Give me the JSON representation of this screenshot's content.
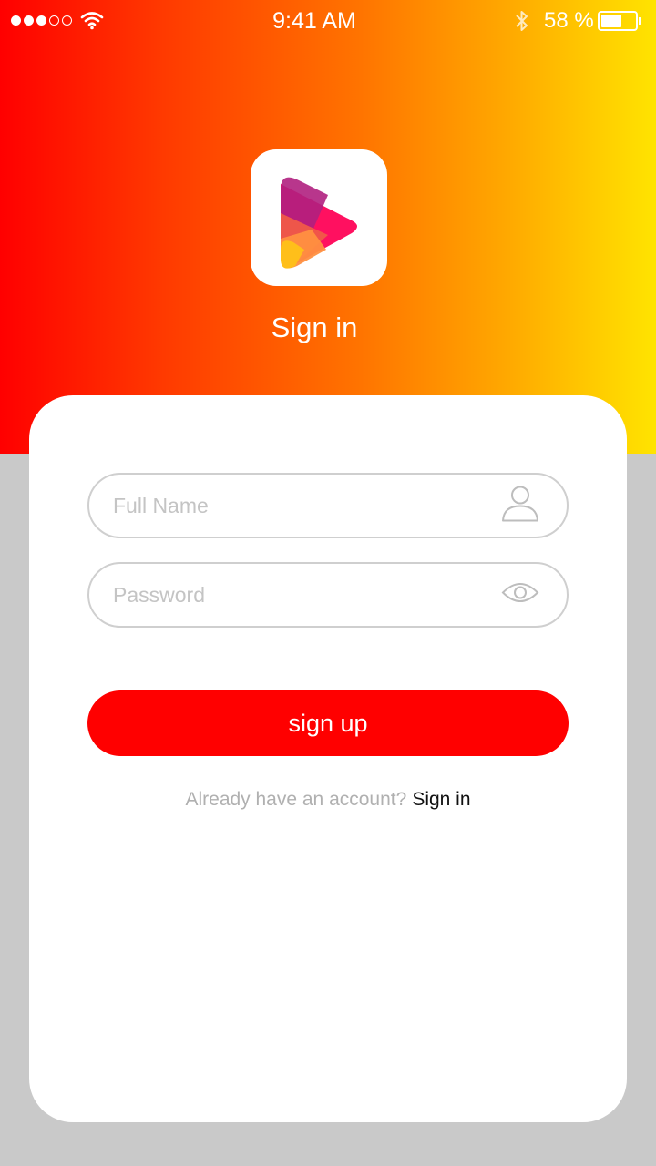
{
  "status_bar": {
    "time": "9:41 AM",
    "battery_percent": "58 %",
    "battery_level": 0.58,
    "signal_bars_filled": 3,
    "signal_bars_total": 5
  },
  "header": {
    "title": "Sign in",
    "app_icon": "play-logo-icon"
  },
  "form": {
    "full_name": {
      "placeholder": "Full Name",
      "value": "",
      "icon": "user-icon"
    },
    "password": {
      "placeholder": "Password",
      "value": "",
      "icon": "eye-icon"
    },
    "submit_label": "sign up"
  },
  "footer": {
    "question": "Already have an account?",
    "link_label": "Sign in"
  },
  "colors": {
    "gradient_start": "#ff0000",
    "gradient_end": "#ffe400",
    "accent": "#ff0000",
    "background": "#c9c9c9"
  }
}
